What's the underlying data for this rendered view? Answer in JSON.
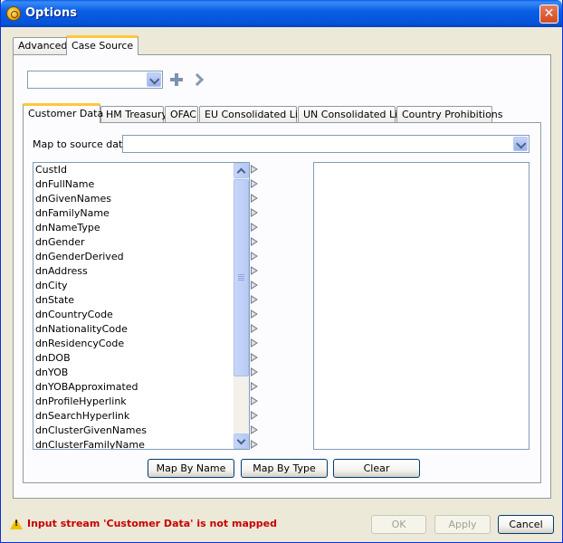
{
  "window": {
    "title": "Options"
  },
  "outer_tabs": [
    {
      "label": "Advanced",
      "active": false
    },
    {
      "label": "Case Source",
      "active": true
    }
  ],
  "source_combo": {
    "value": ""
  },
  "inner_tabs": [
    {
      "label": "Customer Data",
      "active": true
    },
    {
      "label": "HM Treasury",
      "active": false
    },
    {
      "label": "OFAC",
      "active": false
    },
    {
      "label": "EU Consolidated List",
      "active": false
    },
    {
      "label": "UN Consolidated List",
      "active": false
    },
    {
      "label": "Country Prohibitions",
      "active": false
    }
  ],
  "mapping": {
    "label": "Map to source data",
    "value": ""
  },
  "fields": [
    "CustId",
    "dnFullName",
    "dnGivenNames",
    "dnFamilyName",
    "dnNameType",
    "dnGender",
    "dnGenderDerived",
    "dnAddress",
    "dnCity",
    "dnState",
    "dnCountryCode",
    "dnNationalityCode",
    "dnResidencyCode",
    "dnDOB",
    "dnYOB",
    "dnYOBApproximated",
    "dnProfileHyperlink",
    "dnSearchHyperlink",
    "dnClusterGivenNames",
    "dnClusterFamilyName"
  ],
  "list_scroll_position": 0,
  "mapping_buttons": {
    "map_by_name": "Map By Name",
    "map_by_type": "Map By Type",
    "clear": "Clear"
  },
  "status": {
    "message": "Input stream 'Customer Data' is not mapped",
    "color": "#c80000"
  },
  "dialog_buttons": {
    "ok": "OK",
    "apply": "Apply",
    "cancel": "Cancel"
  },
  "colors": {
    "titlebar": "#0453d8",
    "active_tab_accent": "#ffc83c",
    "dialog_bg": "#ece9d8"
  }
}
